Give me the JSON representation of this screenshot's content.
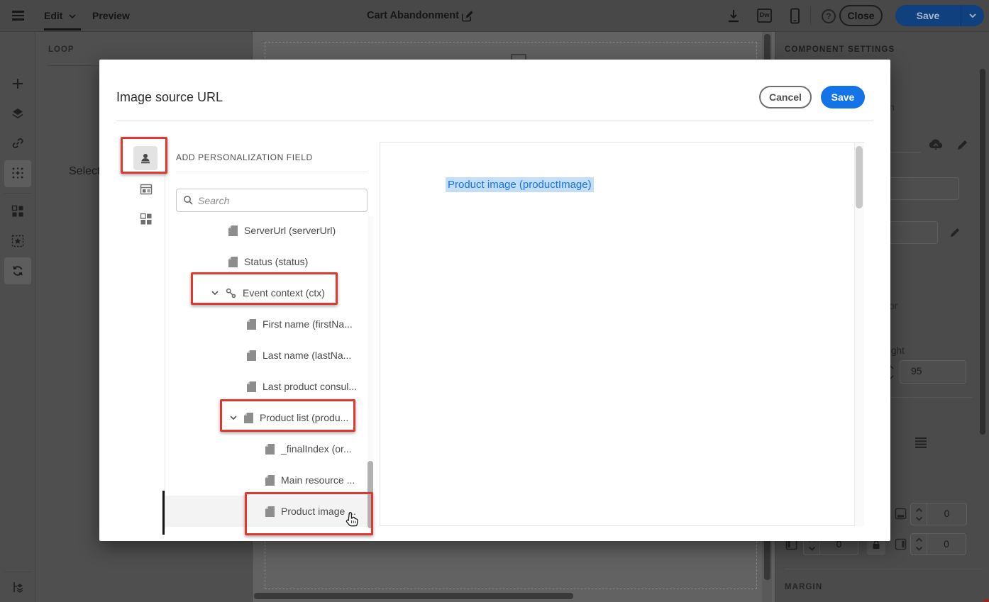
{
  "topbar": {
    "edit": "Edit",
    "preview": "Preview",
    "title": "Cart Abandonment",
    "dw_badge": "Dw",
    "help_glyph": "?",
    "close": "Close",
    "save": "Save"
  },
  "left_rail": {
    "icons": [
      "add",
      "layers",
      "link",
      "personalization",
      "components-grid",
      "fragment-star",
      "sync",
      "structure-tree"
    ]
  },
  "loop_panel": {
    "header": "LOOP",
    "visible_text": "Select"
  },
  "component_panel": {
    "header": "COMPONENT SETTINGS",
    "text_fragment_1": "n",
    "text_fragment_2": "or",
    "text_fragment_3": "ight",
    "height_value": "95",
    "value_row1": "0",
    "value_row2_left": "0",
    "value_row2_right": "0",
    "margin_header": "MARGIN"
  },
  "modal": {
    "title": "Image source URL",
    "cancel": "Cancel",
    "save": "Save",
    "rail_icons": [
      "profile",
      "form-fields",
      "blocks-grid"
    ],
    "panel_header": "ADD PERSONALIZATION FIELD",
    "search_placeholder": "Search",
    "editor_token": "Product image (productImage)",
    "tree": [
      {
        "label": "ServerUrl (serverUrl)",
        "icon": "document"
      },
      {
        "label": "Status (status)",
        "icon": "document"
      },
      {
        "label": "Event context (ctx)",
        "icon": "context-key",
        "expanded": true,
        "annotated": true
      },
      {
        "label": "First name (firstNa...",
        "icon": "document"
      },
      {
        "label": "Last name (lastNa...",
        "icon": "document"
      },
      {
        "label": "Last product consul...",
        "icon": "document"
      },
      {
        "label": "Product list (produ...",
        "icon": "document",
        "expanded": true,
        "annotated": true
      },
      {
        "label": "_finalIndex (or...",
        "icon": "document"
      },
      {
        "label": "Main resource ...",
        "icon": "document"
      },
      {
        "label": "Product image ...",
        "icon": "document",
        "annotated": true,
        "highlighted": true
      }
    ]
  },
  "colors": {
    "accent_blue": "#1473e6",
    "annotation_red": "#dc3a31",
    "token_background": "#c5def7"
  }
}
